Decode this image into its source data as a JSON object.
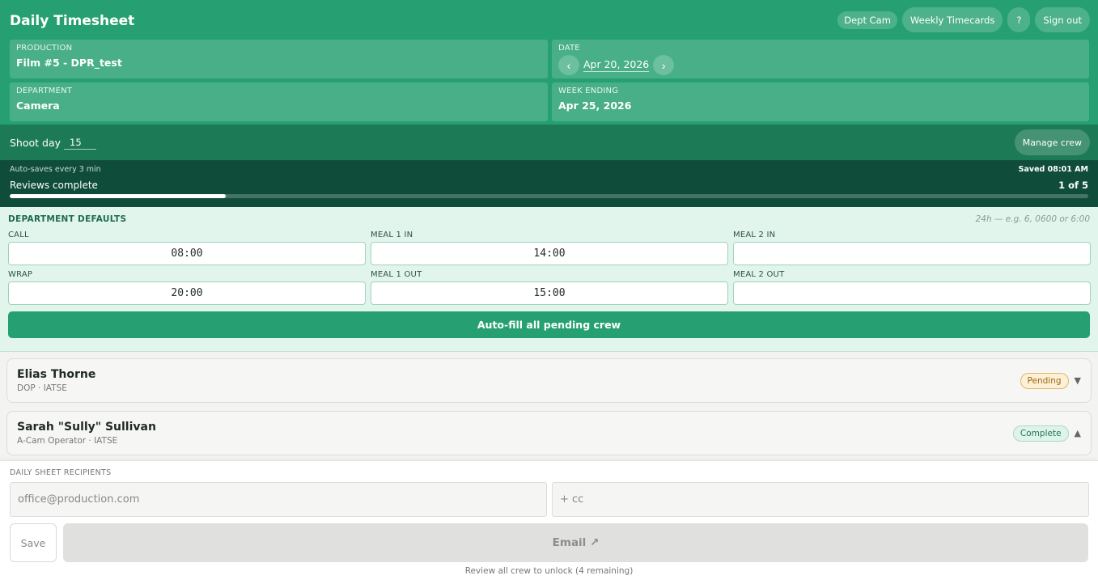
{
  "header": {
    "title": "Daily Timesheet",
    "dept_chip": "Dept Cam",
    "weekly_button": "Weekly Timecards",
    "help_button": "?",
    "signout_button": "Sign out"
  },
  "info": {
    "production": {
      "label": "PRODUCTION",
      "value": "Film #5 - DPR_test"
    },
    "date": {
      "label": "DATE",
      "value": "Apr 20, 2026",
      "prev": "‹",
      "next": "›"
    },
    "department": {
      "label": "DEPARTMENT",
      "value": "Camera"
    },
    "week_ending": {
      "label": "WEEK ENDING",
      "value": "Apr 25, 2026"
    }
  },
  "shoot": {
    "label": "Shoot day",
    "value": "15",
    "manage_button": "Manage crew"
  },
  "progress": {
    "autosave_text": "Auto-saves every 3 min",
    "saved_text": "Saved 08:01 AM",
    "label": "Reviews complete",
    "count_text": "1 of 5",
    "fraction": 0.2
  },
  "defaults": {
    "title": "DEPARTMENT DEFAULTS",
    "hint": "24h — e.g. 6, 0600 or 6:00",
    "fields": {
      "call": {
        "label": "CALL",
        "value": "08:00"
      },
      "meal1_in": {
        "label": "MEAL 1 IN",
        "value": "14:00"
      },
      "meal2_in": {
        "label": "MEAL 2 IN",
        "value": ""
      },
      "wrap": {
        "label": "WRAP",
        "value": "20:00"
      },
      "meal1_out": {
        "label": "MEAL 1 OUT",
        "value": "15:00"
      },
      "meal2_out": {
        "label": "MEAL 2 OUT",
        "value": ""
      }
    },
    "autofill_button": "Auto-fill all pending crew"
  },
  "crew": [
    {
      "name": "Elias Thorne",
      "role": "DOP · IATSE",
      "status": "Pending",
      "chevron": "▼"
    },
    {
      "name": "Sarah \"Sully\" Sullivan",
      "role": "A-Cam Operator · IATSE",
      "status": "Complete",
      "chevron": "▲"
    }
  ],
  "footer": {
    "recipients_label": "DAILY SHEET RECIPIENTS",
    "to_placeholder": "office@production.com",
    "cc_placeholder": "+ cc",
    "save_button": "Save",
    "email_button": "Email ↗",
    "unlock_text": "Review all crew to unlock (4 remaining)"
  },
  "colors": {
    "brand": "#26a073",
    "brand_dark": "#1d7a56",
    "progress_bg": "#0f4d3a",
    "defaults_bg": "#e2f5ec"
  }
}
